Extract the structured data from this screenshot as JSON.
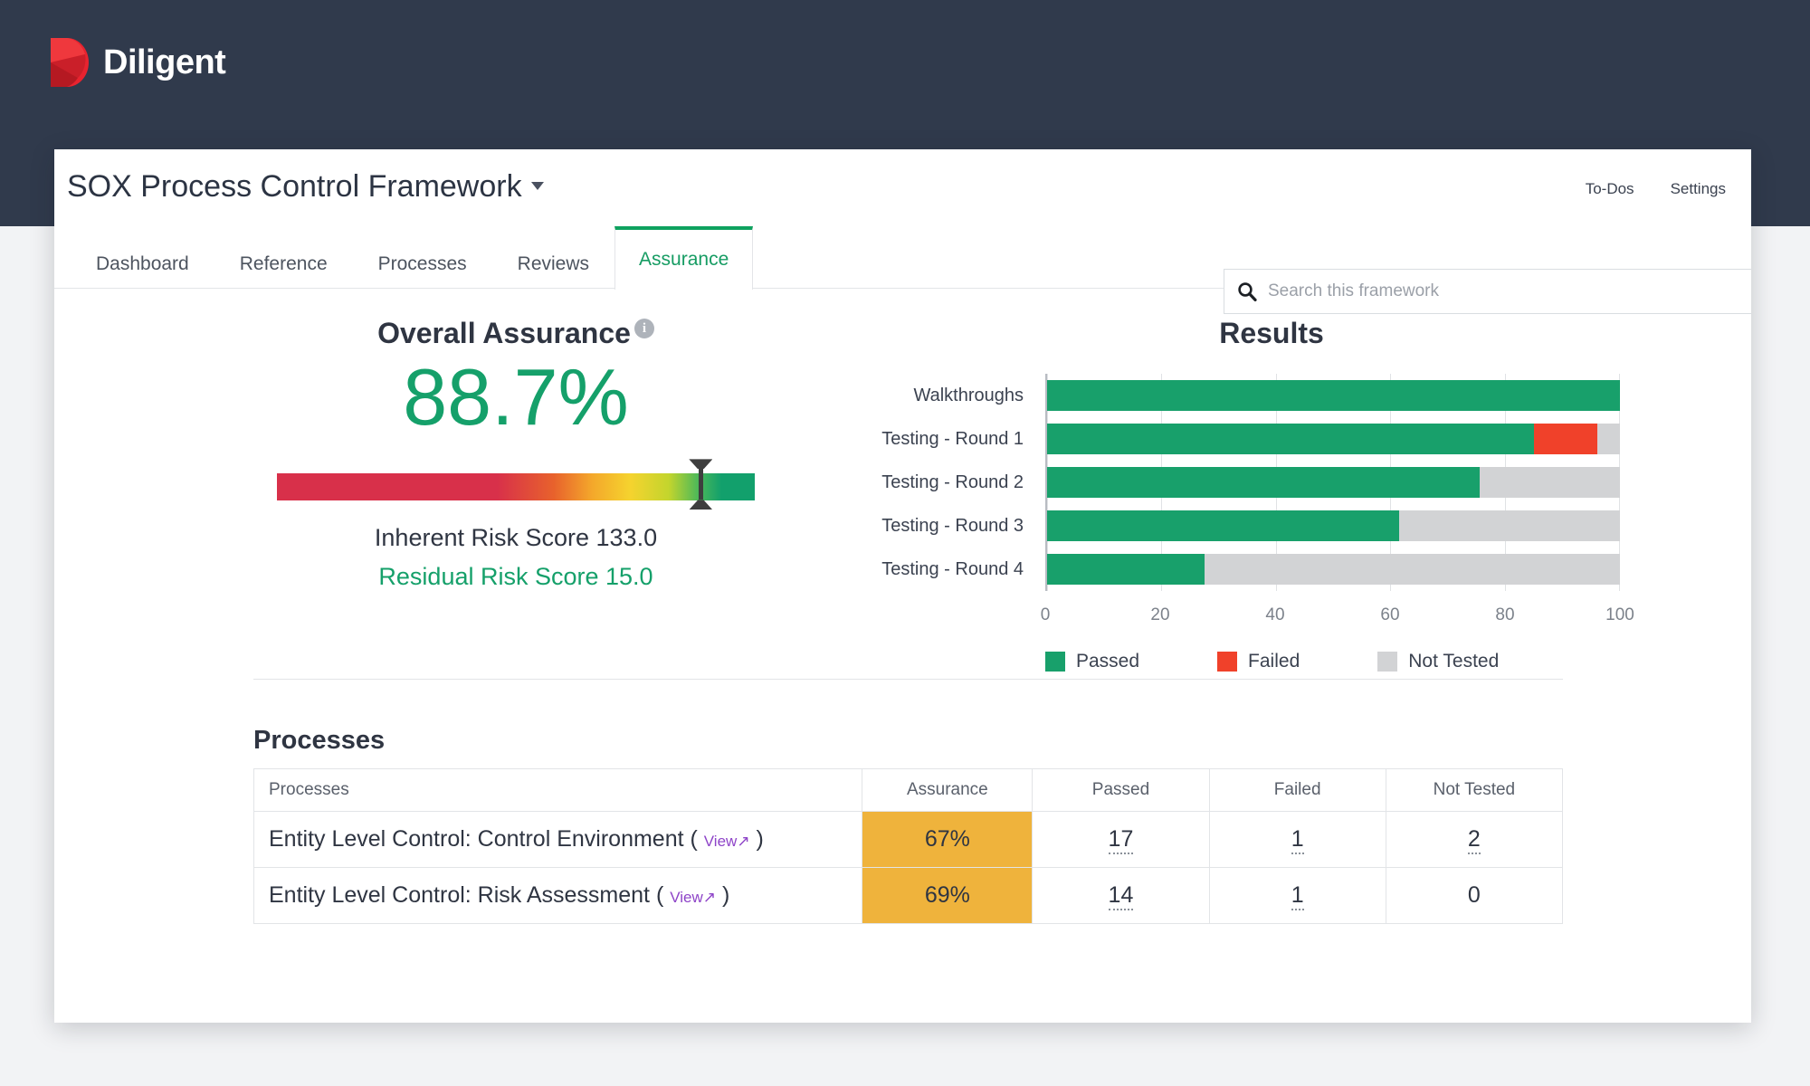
{
  "brand": {
    "name": "Diligent",
    "logo_icon": "diligent-d-logo",
    "band_color": "#303a4c"
  },
  "header": {
    "title": "SOX Process Control Framework",
    "caret_icon": "chevron-down-icon",
    "links": [
      "To-Dos",
      "Settings"
    ]
  },
  "tabs": [
    {
      "label": "Dashboard",
      "active": false
    },
    {
      "label": "Reference",
      "active": false
    },
    {
      "label": "Processes",
      "active": false
    },
    {
      "label": "Reviews",
      "active": false
    },
    {
      "label": "Assurance",
      "active": true
    }
  ],
  "search": {
    "placeholder": "Search this framework",
    "value": "",
    "icon": "search-icon"
  },
  "assurance": {
    "heading": "Overall Assurance",
    "info_icon": "info-icon",
    "value": "88.7%",
    "gauge_position_pct": 88.7,
    "inherent_risk": "Inherent Risk Score 133.0",
    "residual_risk": "Residual Risk Score 15.0",
    "value_color": "#15a06a"
  },
  "chart_data": {
    "type": "bar",
    "orientation": "horizontal",
    "stacked": true,
    "title": "Results",
    "categories": [
      "Walkthroughs",
      "Testing - Round 1",
      "Testing - Round 2",
      "Testing - Round 3",
      "Testing - Round 4"
    ],
    "series": [
      {
        "name": "Passed",
        "color": "#18a06b",
        "values": [
          100,
          85,
          75.5,
          61.5,
          27.5
        ]
      },
      {
        "name": "Failed",
        "color": "#f0412a",
        "values": [
          0,
          11,
          0,
          0,
          0
        ]
      },
      {
        "name": "Not Tested",
        "color": "#d2d3d5",
        "values": [
          0,
          4,
          24.5,
          38.5,
          72.5
        ]
      }
    ],
    "xlabel": "",
    "ylabel": "",
    "xlim": [
      0,
      100
    ],
    "xticks": [
      0,
      20,
      40,
      60,
      80,
      100
    ],
    "grid": true,
    "legend": [
      "Passed",
      "Failed",
      "Not Tested"
    ],
    "legend_position": "bottom"
  },
  "processes": {
    "heading": "Processes",
    "columns": [
      "Processes",
      "Assurance",
      "Passed",
      "Failed",
      "Not Tested"
    ],
    "view_label": "View",
    "view_arrow": "↗",
    "rows": [
      {
        "name": "Entity Level Control: Control Environment",
        "assurance": "67%",
        "assurance_color": "#efb33c",
        "passed": "17",
        "failed": "1",
        "not_tested": "2"
      },
      {
        "name": "Entity Level Control: Risk Assessment",
        "assurance": "69%",
        "assurance_color": "#efb33c",
        "passed": "14",
        "failed": "1",
        "not_tested": "0"
      }
    ]
  }
}
